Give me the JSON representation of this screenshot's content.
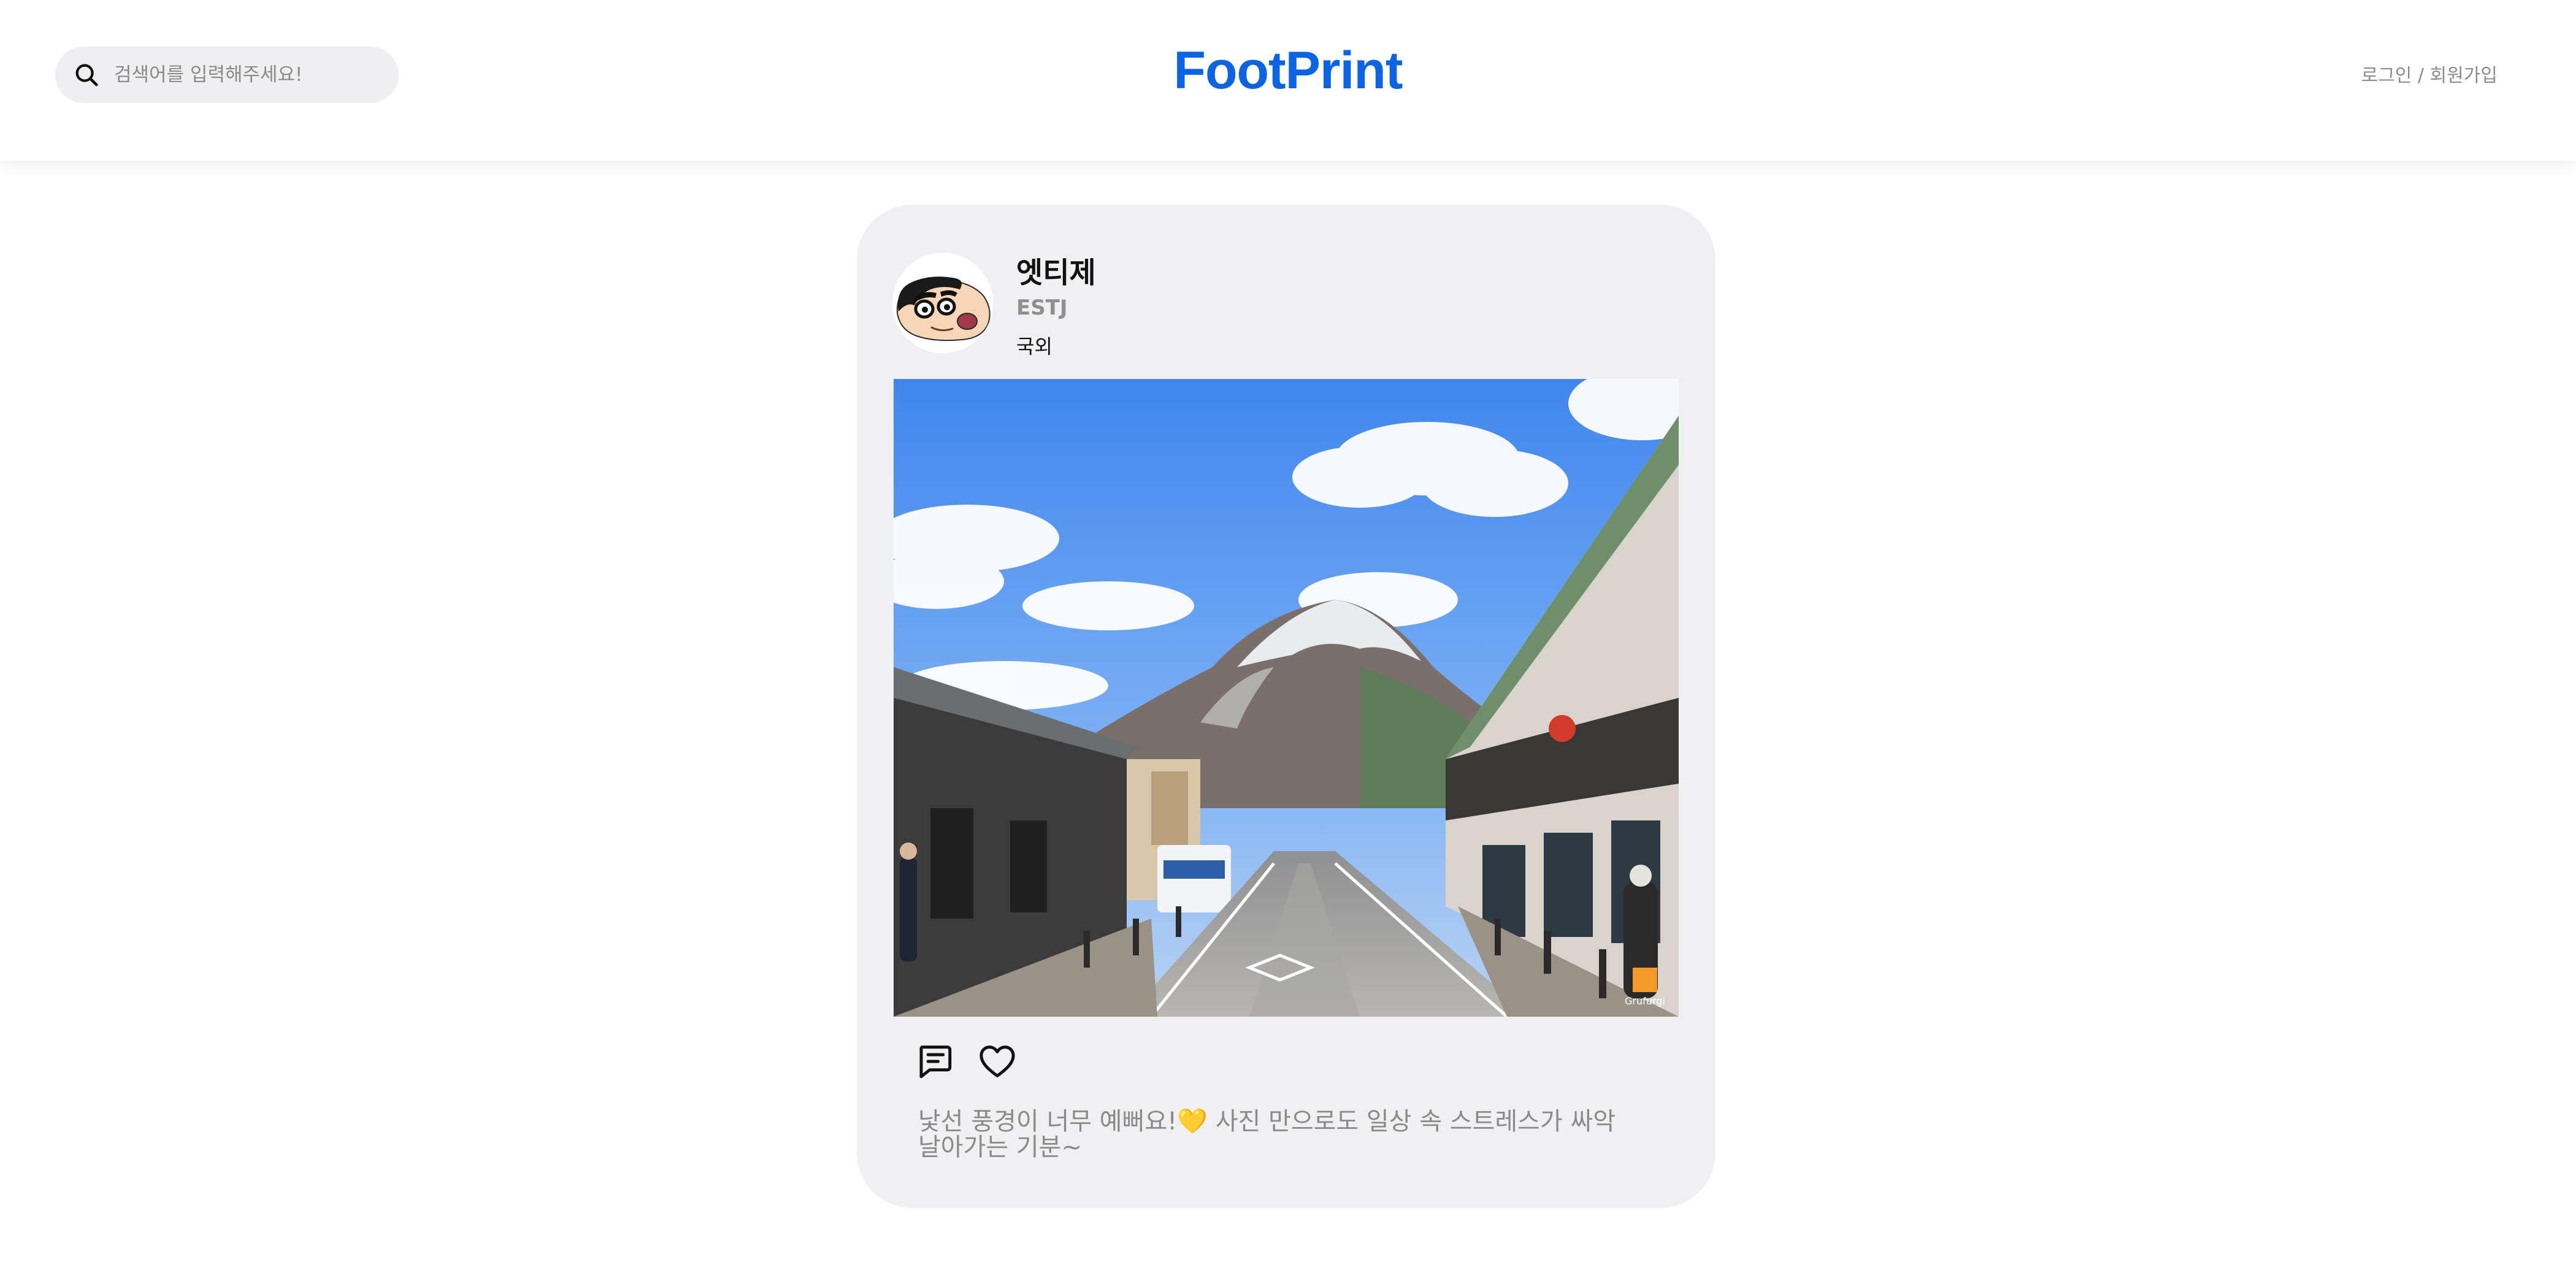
{
  "header": {
    "logo": "FootPrint",
    "search": {
      "placeholder": "검색어를 입력해주세요!",
      "value": "",
      "icon": "search-icon"
    },
    "auth_link": "로그인 / 회원가입"
  },
  "post": {
    "user": {
      "name": "엣티제",
      "mbti": "ESTJ",
      "avatar_icon": "cartoon-boy-avatar"
    },
    "category": "국외",
    "image": {
      "description_icon": "mountain-street-photo",
      "watermark": "Grufurgi"
    },
    "actions": [
      {
        "name": "comment",
        "icon": "comment-icon"
      },
      {
        "name": "like",
        "icon": "heart-icon"
      }
    ],
    "caption": "낯선 풍경이 너무 예뻐요!💛 사진 만으로도 일상 속 스트레스가 싸악 날아가는 기분~"
  },
  "colors": {
    "brand": "#0b63e6",
    "card_bg": "#f0f0f2",
    "muted_text": "#8a8a8a"
  }
}
